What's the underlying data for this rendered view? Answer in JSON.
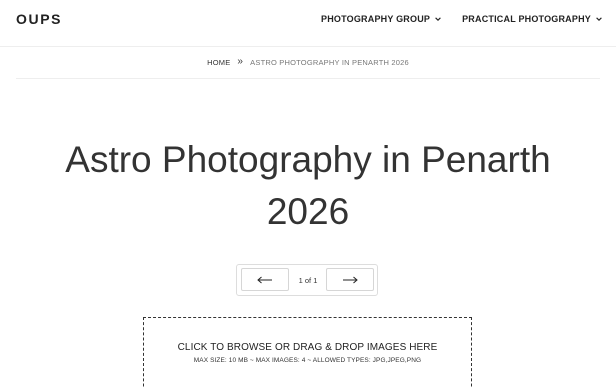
{
  "header": {
    "brand": "OUPS",
    "nav": [
      {
        "label": "PHOTOGRAPHY GROUP",
        "icon": "chevron-down-icon"
      },
      {
        "label": "PRACTICAL PHOTOGRAPHY",
        "icon": "chevron-down-icon"
      }
    ]
  },
  "breadcrumb": {
    "home": "HOME",
    "separator": "»",
    "current": "ASTRO PHOTOGRAPHY IN PENARTH 2026"
  },
  "main": {
    "title_line1": "Astro Photography in Penarth",
    "title_line2": "2026"
  },
  "pager": {
    "prev_icon": "arrow-left-icon",
    "count": "1 of 1",
    "next_icon": "arrow-right-icon"
  },
  "dropzone": {
    "main": "CLICK TO BROWSE OR DRAG & DROP IMAGES HERE",
    "sub": "MAX SIZE: 10 MB ~ MAX IMAGES: 4 ~ ALLOWED TYPES: JPG,JPEG,PNG"
  }
}
